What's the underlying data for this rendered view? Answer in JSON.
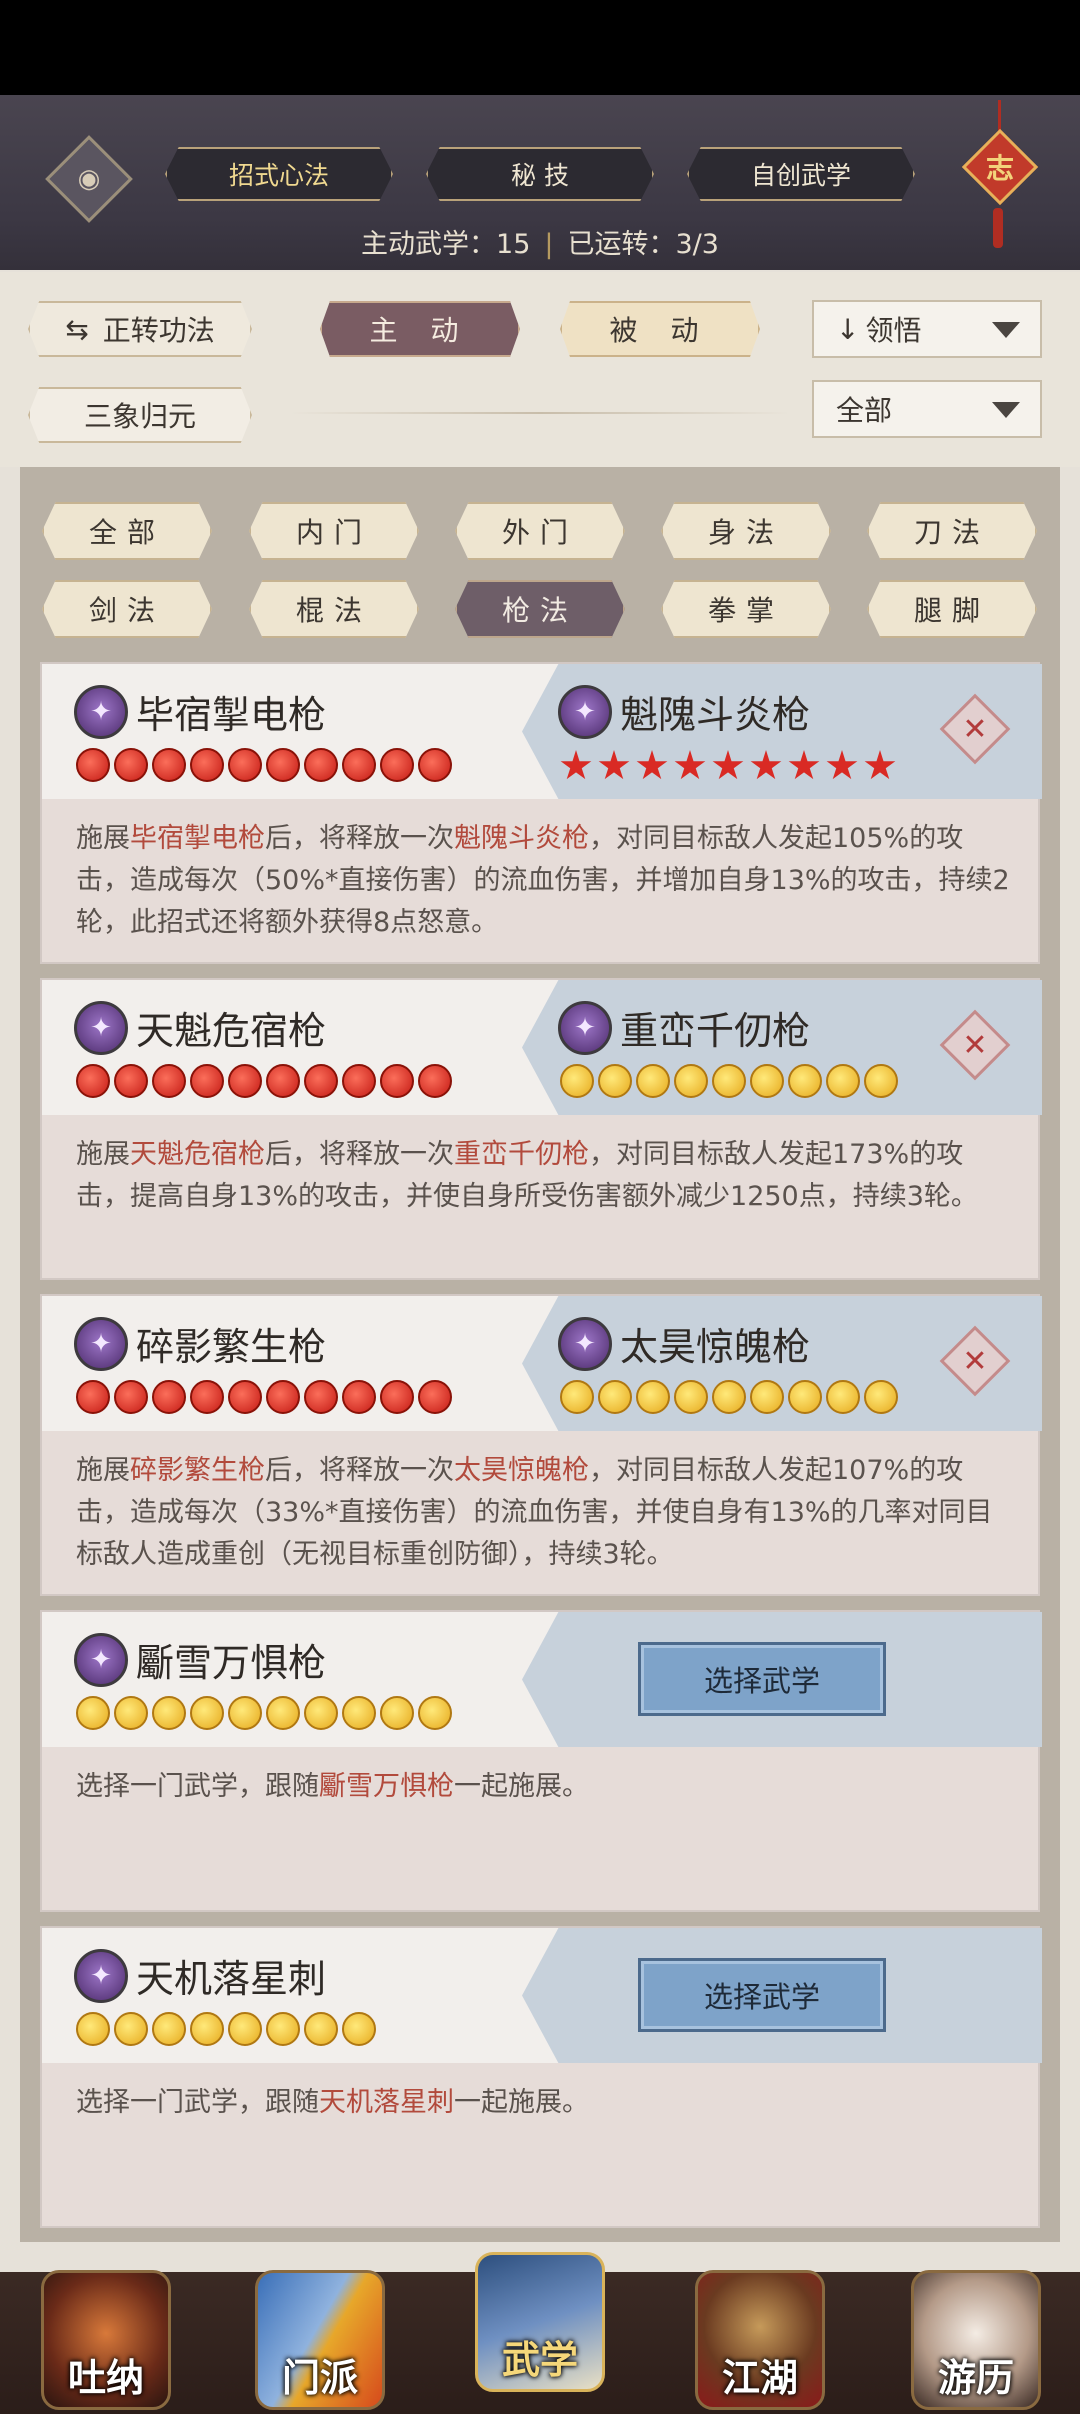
{
  "top_tabs": [
    "招式心法",
    "秘 技",
    "自创武学"
  ],
  "active_top_tab": 0,
  "stats": {
    "active_label": "主动武学：15",
    "running_label": "已运转：3/3"
  },
  "knot_char": "志",
  "eye_icon": "eye-icon",
  "filters": {
    "toggle_label": "正转功法",
    "mode_active": "主 动",
    "mode_passive": "被 动",
    "sort_label": "领悟",
    "sort_arrow": "↓",
    "sanxiang_label": "三象归元",
    "scope_label": "全部"
  },
  "categories": [
    "全部",
    "内门",
    "外门",
    "身法",
    "刀法",
    "剑法",
    "棍法",
    "枪法",
    "拳掌",
    "腿脚"
  ],
  "active_category": 7,
  "cards": [
    {
      "left_name": "毕宿掣电枪",
      "right_name": "魁隗斗炎枪",
      "left_pips": "red",
      "right_pips": "star",
      "desc_pre": "施展",
      "desc_a": "毕宿掣电枪",
      "desc_mid": "后，将释放一次",
      "desc_b": "魁隗斗炎枪",
      "desc_post": "，对同目标敌人发起105%的攻击，造成每次（50%*直接伤害）的流血伤害，并增加自身13%的攻击，持续2轮，此招式还将额外获得8点怒意。"
    },
    {
      "left_name": "天魁危宿枪",
      "right_name": "重峦千仞枪",
      "left_pips": "red",
      "right_pips": "gold",
      "desc_pre": "施展",
      "desc_a": "天魁危宿枪",
      "desc_mid": "后，将释放一次",
      "desc_b": "重峦千仞枪",
      "desc_post": "，对同目标敌人发起173%的攻击，提高自身13%的攻击，并使自身所受伤害额外减少1250点，持续3轮。"
    },
    {
      "left_name": "碎影繁生枪",
      "right_name": "太昊惊魄枪",
      "left_pips": "red",
      "right_pips": "gold",
      "desc_pre": "施展",
      "desc_a": "碎影繁生枪",
      "desc_mid": "后，将释放一次",
      "desc_b": "太昊惊魄枪",
      "desc_post": "，对同目标敌人发起107%的攻击，造成每次（33%*直接伤害）的流血伤害，并使自身有13%的几率对同目标敌人造成重创（无视目标重创防御），持续3轮。"
    },
    {
      "left_name": "斸雪万惧枪",
      "select_label": "选择武学",
      "left_pips": "gold",
      "desc_pre": "选择一门武学，跟随",
      "desc_a": "斸雪万惧枪",
      "desc_post": "一起施展。"
    },
    {
      "left_name": "天机落星刺",
      "select_label": "选择武学",
      "left_pips": "gold",
      "desc_pre": "选择一门武学，跟随",
      "desc_a": "天机落星刺",
      "desc_post": "一起施展。"
    }
  ],
  "nav": [
    "吐纳",
    "门派",
    "武学",
    "江湖",
    "游历"
  ],
  "active_nav": 2,
  "colors": {
    "highlight": "#b24a3c",
    "active_tab": "#7a5c63",
    "select_button": "#7ea3c9"
  }
}
